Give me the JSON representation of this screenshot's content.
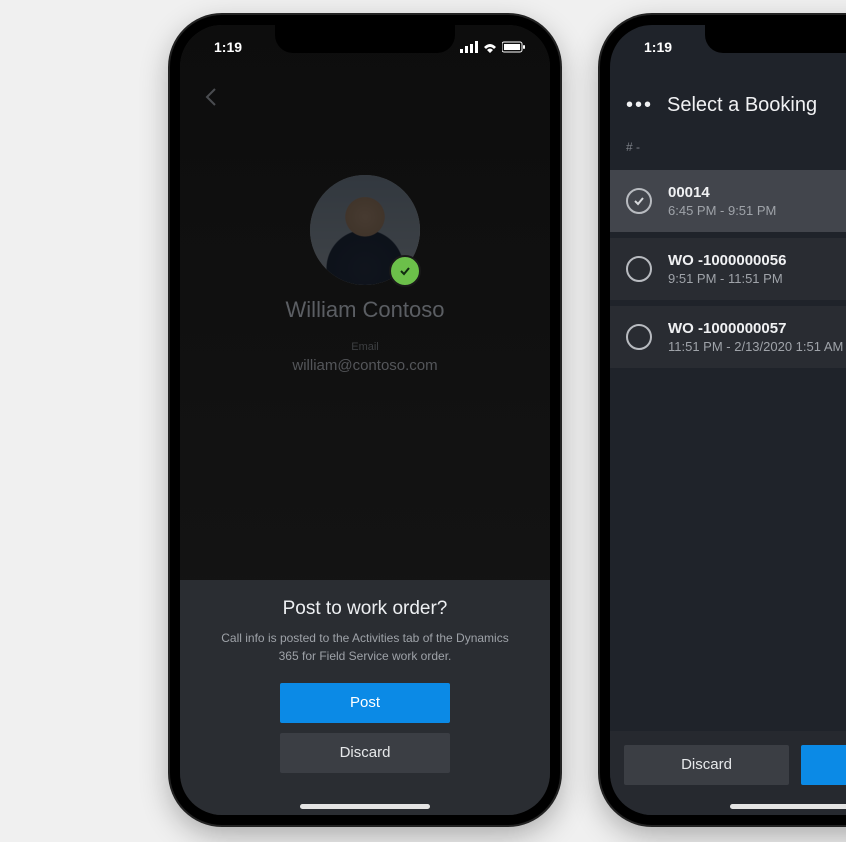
{
  "status": {
    "time": "1:19"
  },
  "phone1": {
    "profile": {
      "name": "William Contoso",
      "email_label": "Email",
      "email": "william@contoso.com"
    },
    "sheet": {
      "title": "Post to work order?",
      "subtitle": "Call info is posted to the Activities tab of the Dynamics 365 for Field Service work order.",
      "post": "Post",
      "discard": "Discard"
    }
  },
  "phone2": {
    "nav_title": "Select a Booking",
    "subheader": "# -",
    "items": [
      {
        "title": "00014",
        "time": "6:45 PM - 9:51 PM",
        "selected": true
      },
      {
        "title": "WO -1000000056",
        "time": "9:51 PM - 11:51 PM",
        "selected": false
      },
      {
        "title": "WO -1000000057",
        "time": "11:51 PM - 2/13/2020 1:51 AM",
        "selected": false
      }
    ],
    "discard": "Discard"
  }
}
